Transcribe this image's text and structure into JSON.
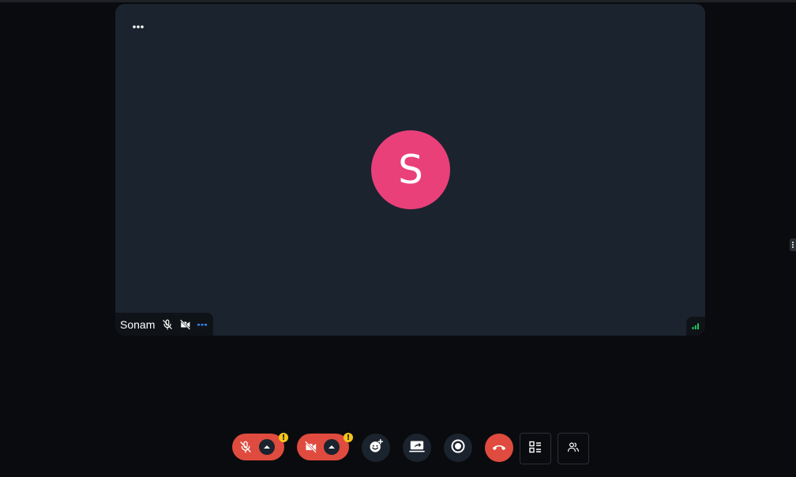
{
  "participant": {
    "initial": "S",
    "name": "Sonam",
    "avatar_color": "#e9407a"
  },
  "icons": {
    "tile_menu": "more-horizontal-icon",
    "mic_status": "mic-off-icon",
    "camera_status": "camera-off-icon",
    "participant_options": "more-horizontal-icon",
    "network": "signal-bars-icon",
    "side_handle": "more-vertical-icon"
  },
  "toolbar": {
    "mic": {
      "icon": "mic-off-icon",
      "caret_icon": "chevron-up-icon",
      "warning": "!"
    },
    "camera": {
      "icon": "camera-off-icon",
      "caret_icon": "chevron-up-icon",
      "warning": "!"
    },
    "reactions": {
      "icon": "emoji-add-icon"
    },
    "screen_share": {
      "icon": "screen-share-icon"
    },
    "record": {
      "icon": "record-icon"
    },
    "leave": {
      "icon": "phone-hangup-icon"
    },
    "layout": {
      "icon": "layout-list-icon"
    },
    "participants": {
      "icon": "people-icon"
    }
  },
  "colors": {
    "background": "#0a0b0e",
    "tile": "#1b232e",
    "danger": "#e04b3f",
    "warning": "#f5c518",
    "accent_blue": "#3b82f6",
    "signal_green": "#22c55e"
  }
}
